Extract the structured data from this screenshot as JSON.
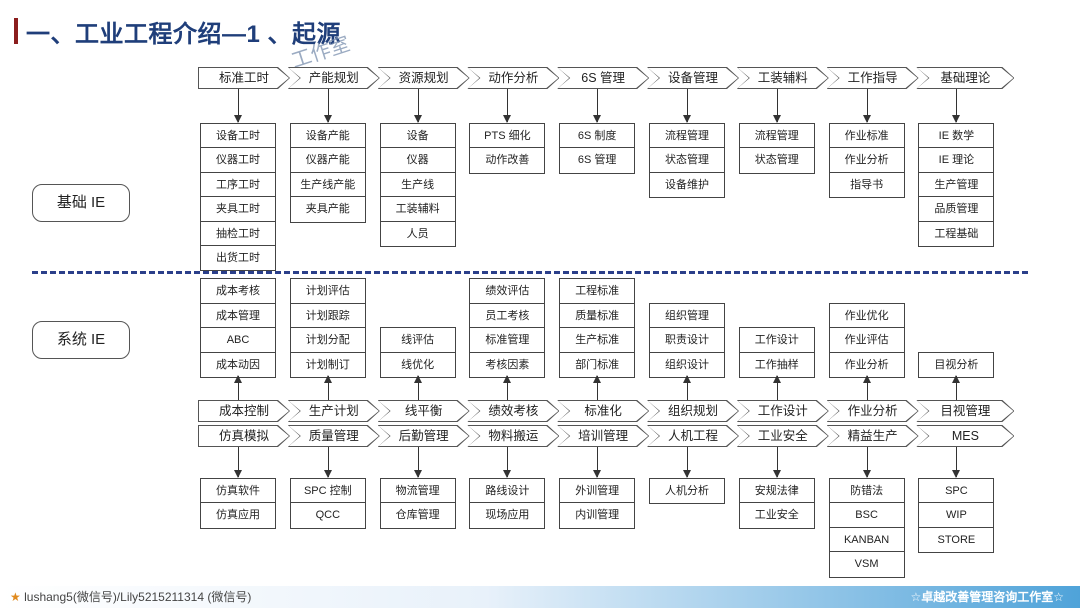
{
  "header": {
    "title": "一、工业工程介绍—1 、起源",
    "watermark": "工作室"
  },
  "labels": {
    "basic": "基础 IE",
    "system": "系统 IE"
  },
  "top_phases": [
    "标准工时",
    "产能规划",
    "资源规划",
    "动作分析",
    "6S 管理",
    "设备管理",
    "工装辅料",
    "工作指导",
    "基础理论"
  ],
  "top_boxes": [
    [
      "设备工时",
      "仪器工时",
      "工序工时",
      "夹具工时",
      "抽检工时",
      "出货工时"
    ],
    [
      "设备产能",
      "仪器产能",
      "生产线产能",
      "夹具产能"
    ],
    [
      "设备",
      "仪器",
      "生产线",
      "工装辅料",
      "人员"
    ],
    [
      "PTS 细化",
      "动作改善"
    ],
    [
      "6S 制度",
      "6S 管理"
    ],
    [
      "流程管理",
      "状态管理",
      "设备维护"
    ],
    [
      "流程管理",
      "状态管理"
    ],
    [
      "作业标准",
      "作业分析",
      "指导书"
    ],
    [
      "IE 数学",
      "IE 理论",
      "生产管理",
      "品质管理",
      "工程基础"
    ]
  ],
  "mid_boxes": [
    [
      "成本考核",
      "成本管理",
      "ABC",
      "成本动因"
    ],
    [
      "计划评估",
      "计划跟踪",
      "计划分配",
      "计划制订"
    ],
    [
      "线评估",
      "线优化"
    ],
    [
      "绩效评估",
      "员工考核",
      "标准管理",
      "考核因素"
    ],
    [
      "工程标准",
      "质量标准",
      "生产标准",
      "部门标准"
    ],
    [
      "组织管理",
      "职责设计",
      "组织设计"
    ],
    [
      "工作设计",
      "工作抽样"
    ],
    [
      "作业优化",
      "作业评估",
      "作业分析"
    ],
    [
      "目视分析"
    ]
  ],
  "row1_phases": [
    "成本控制",
    "生产计划",
    "线平衡",
    "绩效考核",
    "标准化",
    "组织规划",
    "工作设计",
    "作业分析",
    "目视管理"
  ],
  "row2_phases": [
    "仿真模拟",
    "质量管理",
    "后勤管理",
    "物料搬运",
    "培训管理",
    "人机工程",
    "工业安全",
    "精益生产",
    "MES"
  ],
  "bottom_boxes": [
    [
      "仿真软件",
      "仿真应用"
    ],
    [
      "SPC 控制",
      "QCC"
    ],
    [
      "物流管理",
      "仓库管理"
    ],
    [
      "路线设计",
      "现场应用"
    ],
    [
      "外训管理",
      "内训管理"
    ],
    [
      "人机分析"
    ],
    [
      "安规法律",
      "工业安全"
    ],
    [
      "防错法",
      "BSC",
      "KANBAN",
      "VSM"
    ],
    [
      "SPC",
      "WIP",
      "STORE"
    ]
  ],
  "footer": {
    "left": "lushang5(微信号)/Lily5215211314 (微信号)",
    "right": "☆卓越改善管理咨询工作室☆"
  },
  "colors": {
    "title": "#1f3e7a",
    "dashed_line": "#2b3f8a",
    "footer_accent": "#4fa3d9"
  }
}
